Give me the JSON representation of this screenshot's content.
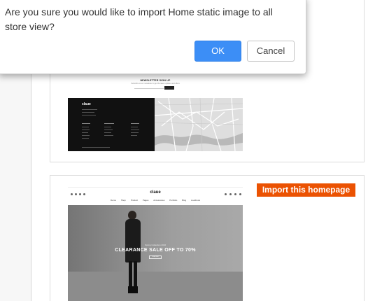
{
  "dialog": {
    "message": "Are you sure you would like to import Home static image to all store view?",
    "ok_label": "OK",
    "cancel_label": "Cancel"
  },
  "preview_footer": {
    "newsletter_title": "NEWSLETTER SIGN UP",
    "newsletter_text": "Subscribe to our newsletter to get the latest updates and offers",
    "subscribe_label": "Subscribe",
    "logo": "claue"
  },
  "preview_home": {
    "logo": "claue",
    "menu": [
      "Demo",
      "Shop",
      "Product",
      "Pages",
      "Accessories",
      "Portfolio",
      "Blog",
      "Lookbook"
    ],
    "eyebrow": "Spring Collection 2016",
    "headline": "CLEARANCE SALE OFF TO 70%",
    "cta": "Shop Now"
  },
  "import_button_label": "Import this homepage",
  "colors": {
    "accent": "#eb5202",
    "ok_button": "#3c8ef6"
  }
}
